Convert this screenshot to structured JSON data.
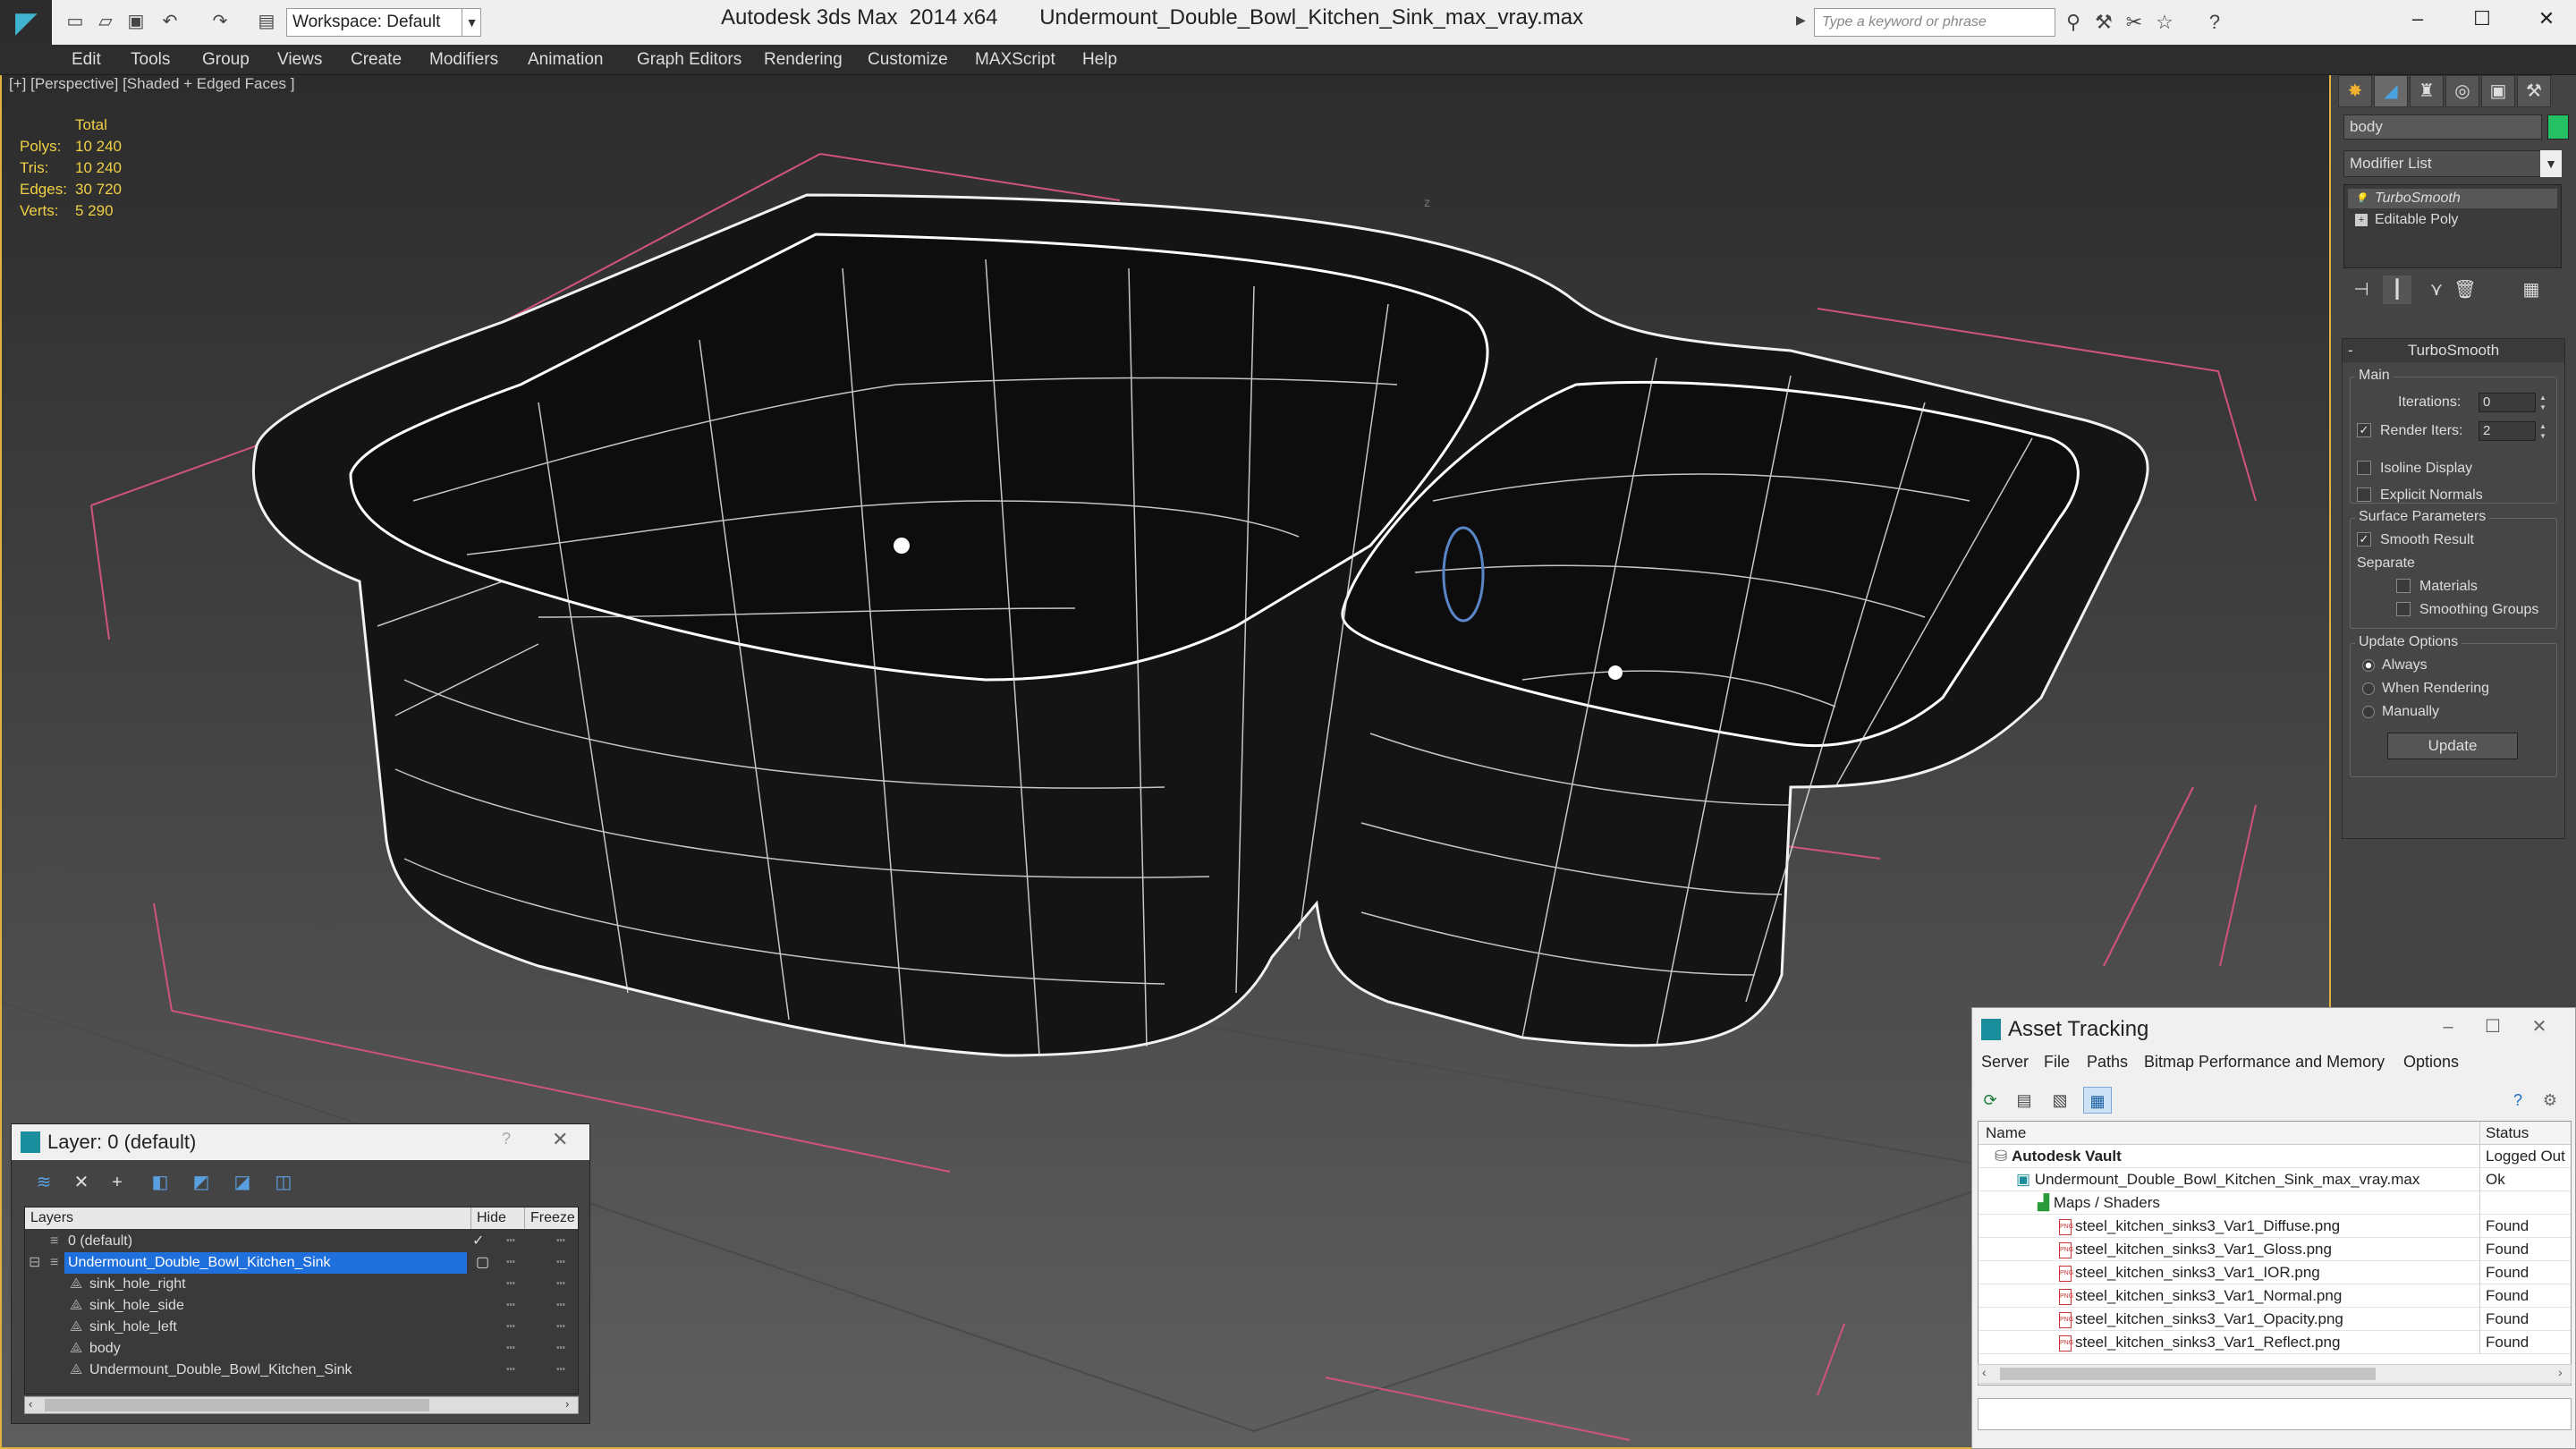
{
  "titlebar": {
    "app_title": "Autodesk 3ds Max  2014 x64",
    "file_name": "Undermount_Double_Bowl_Kitchen_Sink_max_vray.max",
    "workspace": "Workspace: Default",
    "search_placeholder": "Type a keyword or phrase",
    "logo_icon": "3dsmax-logo-icon"
  },
  "menu": [
    "Edit",
    "Tools",
    "Group",
    "Views",
    "Create",
    "Modifiers",
    "Animation",
    "Graph Editors",
    "Rendering",
    "Customize",
    "MAXScript",
    "Help"
  ],
  "viewport": {
    "label": "[+] [Perspective] [Shaded + Edged Faces ]",
    "stats": {
      "header": "Total",
      "rows": [
        {
          "label": "Polys:",
          "value": "10 240"
        },
        {
          "label": "Tris:",
          "value": "10 240"
        },
        {
          "label": "Edges:",
          "value": "30 720"
        },
        {
          "label": "Verts:",
          "value": "5 290"
        }
      ]
    },
    "axis_label": "z"
  },
  "command_panel": {
    "object_name": "body",
    "object_color": "#25c063",
    "modifier_list": "Modifier List",
    "stack": [
      "TurboSmooth",
      "Editable Poly"
    ],
    "rollout_title": "TurboSmooth",
    "main_group": "Main",
    "iterations_label": "Iterations:",
    "iterations_value": "0",
    "render_iters_label": "Render Iters:",
    "render_iters_value": "2",
    "render_iters_checked": true,
    "isoline_label": "Isoline Display",
    "explicit_label": "Explicit Normals",
    "surface_group": "Surface Parameters",
    "smooth_result_label": "Smooth Result",
    "separate_label": "Separate",
    "materials_label": "Materials",
    "smoothing_groups_label": "Smoothing Groups",
    "update_group": "Update Options",
    "always_label": "Always",
    "when_rendering_label": "When Rendering",
    "manually_label": "Manually",
    "update_button": "Update"
  },
  "layer_panel": {
    "title": "Layer: 0 (default)",
    "col_layers": "Layers",
    "col_hide": "Hide",
    "col_freeze": "Freeze",
    "rows": [
      {
        "name": "0 (default)",
        "indent": 1,
        "selected": false
      },
      {
        "name": "Undermount_Double_Bowl_Kitchen_Sink",
        "indent": 1,
        "selected": true
      },
      {
        "name": "sink_hole_right",
        "indent": 2,
        "selected": false
      },
      {
        "name": "sink_hole_side",
        "indent": 2,
        "selected": false
      },
      {
        "name": "sink_hole_left",
        "indent": 2,
        "selected": false
      },
      {
        "name": "body",
        "indent": 2,
        "selected": false
      },
      {
        "name": "Undermount_Double_Bowl_Kitchen_Sink",
        "indent": 2,
        "selected": false
      }
    ]
  },
  "asset_panel": {
    "title": "Asset Tracking",
    "menu": [
      "Server",
      "File",
      "Paths",
      "Bitmap Performance and Memory",
      "Options"
    ],
    "col_name": "Name",
    "col_status": "Status",
    "rows": [
      {
        "name": "Autodesk Vault",
        "status": "Logged Out",
        "indent": 1,
        "icon": "vault-icon"
      },
      {
        "name": "Undermount_Double_Bowl_Kitchen_Sink_max_vray.max",
        "status": "Ok",
        "indent": 2,
        "icon": "max-file-icon"
      },
      {
        "name": "Maps / Shaders",
        "status": "",
        "indent": 3,
        "icon": "maps-icon"
      },
      {
        "name": "steel_kitchen_sinks3_Var1_Diffuse.png",
        "status": "Found",
        "indent": 4,
        "icon": "png-icon"
      },
      {
        "name": "steel_kitchen_sinks3_Var1_Gloss.png",
        "status": "Found",
        "indent": 4,
        "icon": "png-icon"
      },
      {
        "name": "steel_kitchen_sinks3_Var1_IOR.png",
        "status": "Found",
        "indent": 4,
        "icon": "png-icon"
      },
      {
        "name": "steel_kitchen_sinks3_Var1_Normal.png",
        "status": "Found",
        "indent": 4,
        "icon": "png-icon"
      },
      {
        "name": "steel_kitchen_sinks3_Var1_Opacity.png",
        "status": "Found",
        "indent": 4,
        "icon": "png-icon"
      },
      {
        "name": "steel_kitchen_sinks3_Var1_Reflect.png",
        "status": "Found",
        "indent": 4,
        "icon": "png-icon"
      }
    ]
  }
}
